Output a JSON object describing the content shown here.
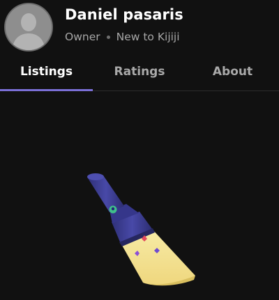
{
  "profile": {
    "name": "Daniel pasaris",
    "role": "Owner",
    "status": "New to Kijiji"
  },
  "tabs": [
    {
      "label": "Listings",
      "active": true
    },
    {
      "label": "Ratings",
      "active": false
    },
    {
      "label": "About",
      "active": false
    }
  ],
  "colors": {
    "background": "#111111",
    "accent": "#7b70d8",
    "flashlight_body": "#3b3c8f",
    "flashlight_beam": "#f3e49a"
  },
  "icons": {
    "avatar": "user-silhouette-icon",
    "empty_state": "flashlight-icon"
  }
}
